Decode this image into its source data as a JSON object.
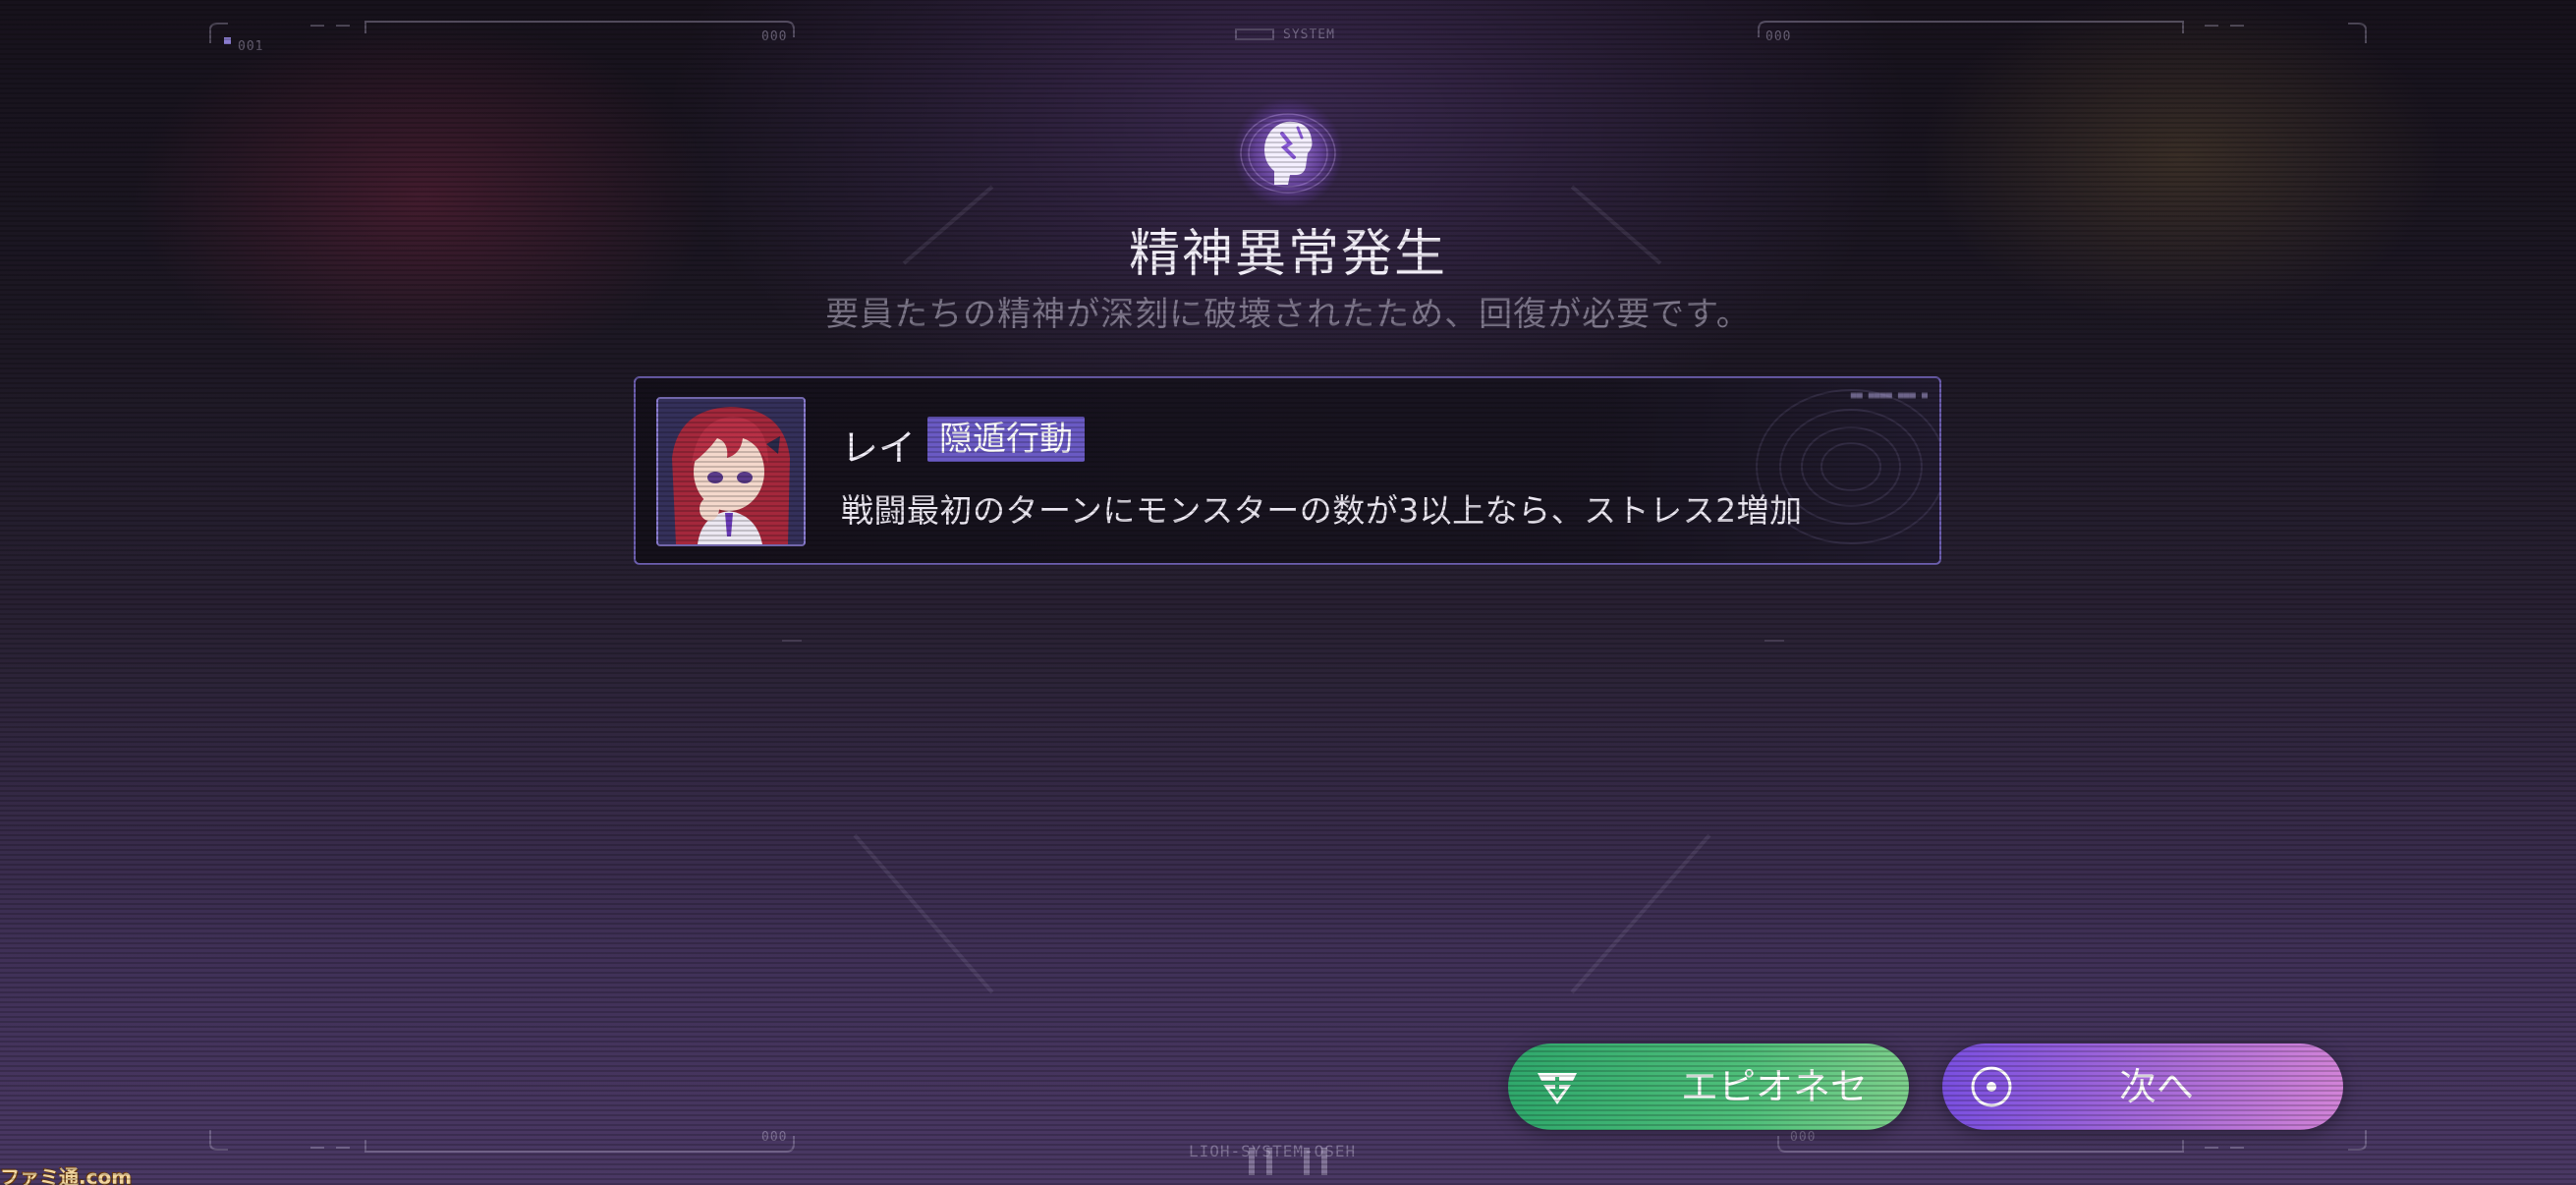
{
  "hud": {
    "top_left_code": "001",
    "top_left_counter": "000",
    "top_center_code": "SYSTEM",
    "top_right_counter": "000",
    "bottom_left_counter": "000",
    "bottom_right_counter": "000",
    "bottom_center_code": "LIOH-SYSTEM-OSEH"
  },
  "event": {
    "icon": "mind-head-icon",
    "title": "精神異常発生",
    "subtitle": "要員たちの精神が深刻に破壊されたため、回復が必要です。"
  },
  "character": {
    "name": "レイ",
    "trait": "隠遁行動",
    "description": "戦闘最初のターンにモンスターの数が3以上なら、ストレス2増加",
    "portrait": "red-haired-girl-portrait"
  },
  "buttons": {
    "episode_label": "エピオネセ",
    "episode_icon": "emblem-icon",
    "next_label": "次へ",
    "next_icon": "target-circle-icon"
  },
  "watermark": "ファミ通.com",
  "colors": {
    "accent_purple": "#6a5ac4",
    "card_border": "#6d5fb0",
    "episode_green": "#3cb474",
    "next_purple": "#a76ad8"
  }
}
